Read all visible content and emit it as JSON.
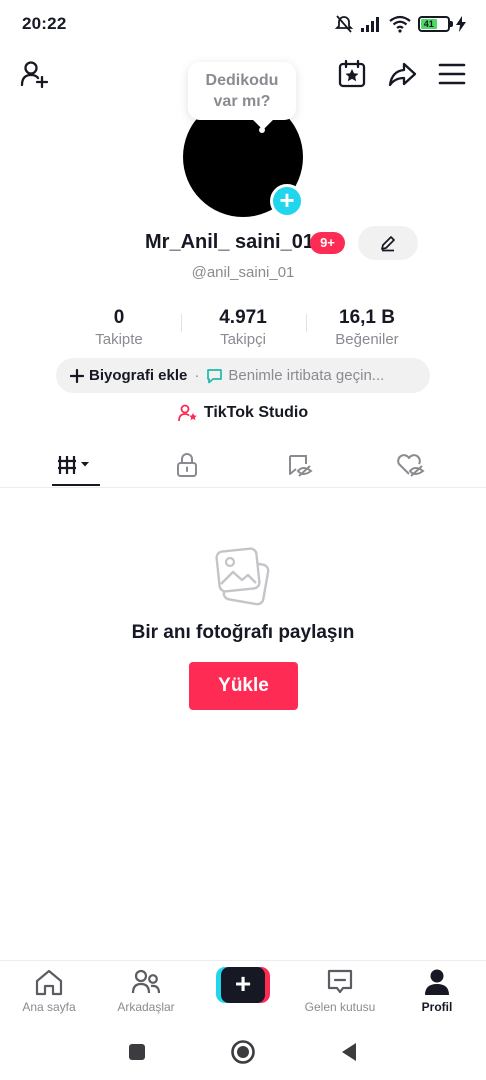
{
  "status_bar": {
    "time": "20:22",
    "battery_level": "41",
    "icons": [
      "mute-icon",
      "signal-icon",
      "wifi-icon",
      "battery-icon",
      "charging-icon"
    ]
  },
  "top_bar": {
    "icons": [
      "add-friend-icon",
      "calendar-star-icon",
      "share-icon",
      "menu-icon"
    ]
  },
  "profile": {
    "bubble_text_line1": "Dedikodu",
    "bubble_text_line2": "var mı?",
    "display_name": "Mr_Anil_ saini_01",
    "notification_badge": "9+",
    "username": "@anil_saini_01",
    "stats": [
      {
        "value": "0",
        "label": "Takipte"
      },
      {
        "value": "4.971",
        "label": "Takipçi"
      },
      {
        "value": "16,1 B",
        "label": "Beğeniler"
      }
    ],
    "bio_add_label": "Biyografi ekle",
    "bio_separator": "·",
    "contact_label": "Benimle irtibata geçin...",
    "studio_label": "TikTok Studio"
  },
  "tabs": [
    {
      "name": "videos",
      "icon": "grid-icon",
      "active": true
    },
    {
      "name": "private",
      "icon": "lock-icon",
      "active": false
    },
    {
      "name": "reposts",
      "icon": "repost-icon",
      "active": false
    },
    {
      "name": "liked",
      "icon": "liked-hidden-icon",
      "active": false
    }
  ],
  "empty_state": {
    "icon": "photo-icon",
    "title": "Bir anı fotoğrafı paylaşın",
    "button_label": "Yükle"
  },
  "bottom_nav": {
    "items": [
      {
        "label": "Ana sayfa",
        "icon": "home-icon"
      },
      {
        "label": "Arkadaşlar",
        "icon": "friends-icon"
      },
      {
        "label": "",
        "icon": "create-plus-icon"
      },
      {
        "label": "Gelen kutusu",
        "icon": "inbox-icon"
      },
      {
        "label": "Profil",
        "icon": "profile-icon"
      }
    ],
    "active": "Profil"
  },
  "colors": {
    "accent": "#fe2c55",
    "cyan": "#20d5ec",
    "text": "#161823",
    "muted": "#8a8b91"
  }
}
